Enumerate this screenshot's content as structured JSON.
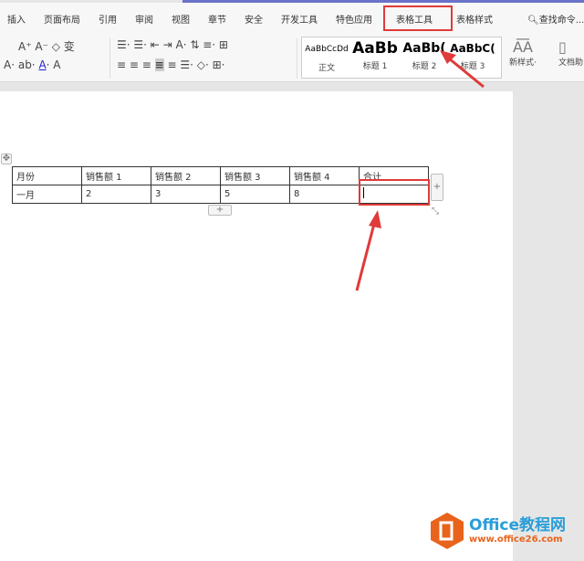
{
  "tabs": [
    "插入",
    "页面布局",
    "引用",
    "审阅",
    "视图",
    "章节",
    "安全",
    "开发工具",
    "特色应用",
    "表格工具",
    "表格样式"
  ],
  "search_label": "查找命令...",
  "styles": [
    {
      "preview": "AaBbCcDd",
      "label": "正文"
    },
    {
      "preview": "AaBb",
      "label": "标题 1"
    },
    {
      "preview": "AaBb(",
      "label": "标题 2"
    },
    {
      "preview": "AaBbC(",
      "label": "标题 3"
    }
  ],
  "new_style_label": "新样式",
  "doc_helper_label": "文档助",
  "table": {
    "headers": [
      "月份",
      "销售额 1",
      "销售额 2",
      "销售额 3",
      "销售额 4",
      "合计"
    ],
    "rows": [
      [
        "一月",
        "2",
        "3",
        "5",
        "8",
        ""
      ]
    ]
  },
  "watermark": {
    "title": "Office教程网",
    "url": "www.office26.com"
  },
  "colors": {
    "highlight": "#e03a3a",
    "logo": "#e8641c",
    "logo_text": "#2a9ed8"
  }
}
